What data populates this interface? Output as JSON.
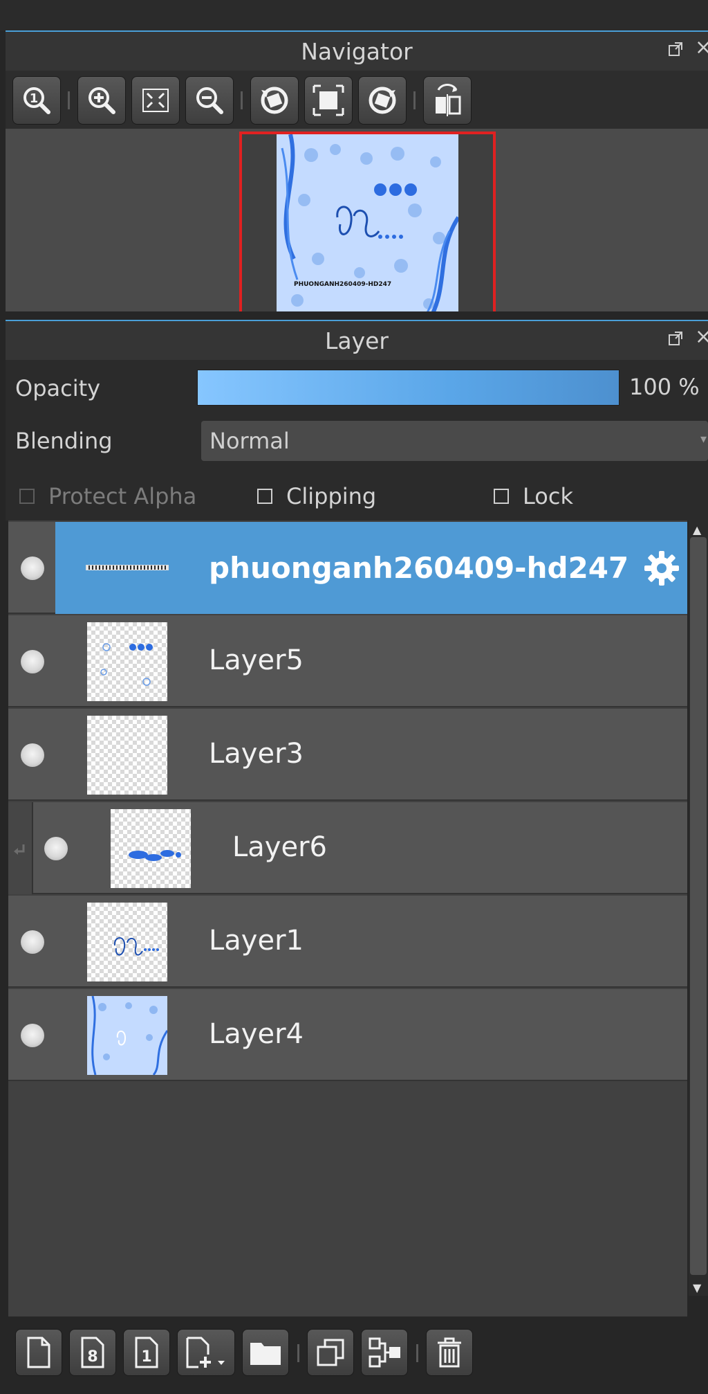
{
  "navigator": {
    "title": "Navigator",
    "toolbar": [
      {
        "name": "zoom-actual-icon"
      },
      {
        "name": "zoom-in-icon"
      },
      {
        "name": "fit-screen-icon"
      },
      {
        "name": "zoom-out-icon"
      },
      {
        "name": "rotate-left-icon"
      },
      {
        "name": "reset-rotation-icon"
      },
      {
        "name": "rotate-right-icon"
      },
      {
        "name": "flip-horizontal-icon"
      }
    ],
    "preview_caption": "PHUONGANH260409-HD247"
  },
  "layer_panel": {
    "title": "Layer",
    "opacity_label": "Opacity",
    "opacity_value": "100 %",
    "opacity_fraction": 1.0,
    "blending_label": "Blending",
    "blending_value": "Normal",
    "protect_alpha_label": "Protect Alpha",
    "clipping_label": "Clipping",
    "lock_label": "Lock"
  },
  "layers": [
    {
      "name": "phuonganh260409-hd247",
      "selected": true
    },
    {
      "name": "Layer5"
    },
    {
      "name": "Layer3"
    },
    {
      "name": "Layer6",
      "clipped": true
    },
    {
      "name": "Layer1"
    },
    {
      "name": "Layer4"
    }
  ],
  "bottom_toolbar": [
    {
      "name": "new-layer-icon"
    },
    {
      "name": "new-8bit-layer-icon"
    },
    {
      "name": "new-1bit-layer-icon"
    },
    {
      "name": "add-layer-menu-icon"
    },
    {
      "name": "new-folder-icon"
    },
    {
      "name": "duplicate-layer-icon"
    },
    {
      "name": "merge-down-icon"
    },
    {
      "name": "delete-layer-icon"
    }
  ],
  "colors": {
    "accent": "#4f9ad5",
    "frame_red": "#e02121",
    "panel_bg": "#2b2b2b",
    "row_bg": "#555555"
  }
}
